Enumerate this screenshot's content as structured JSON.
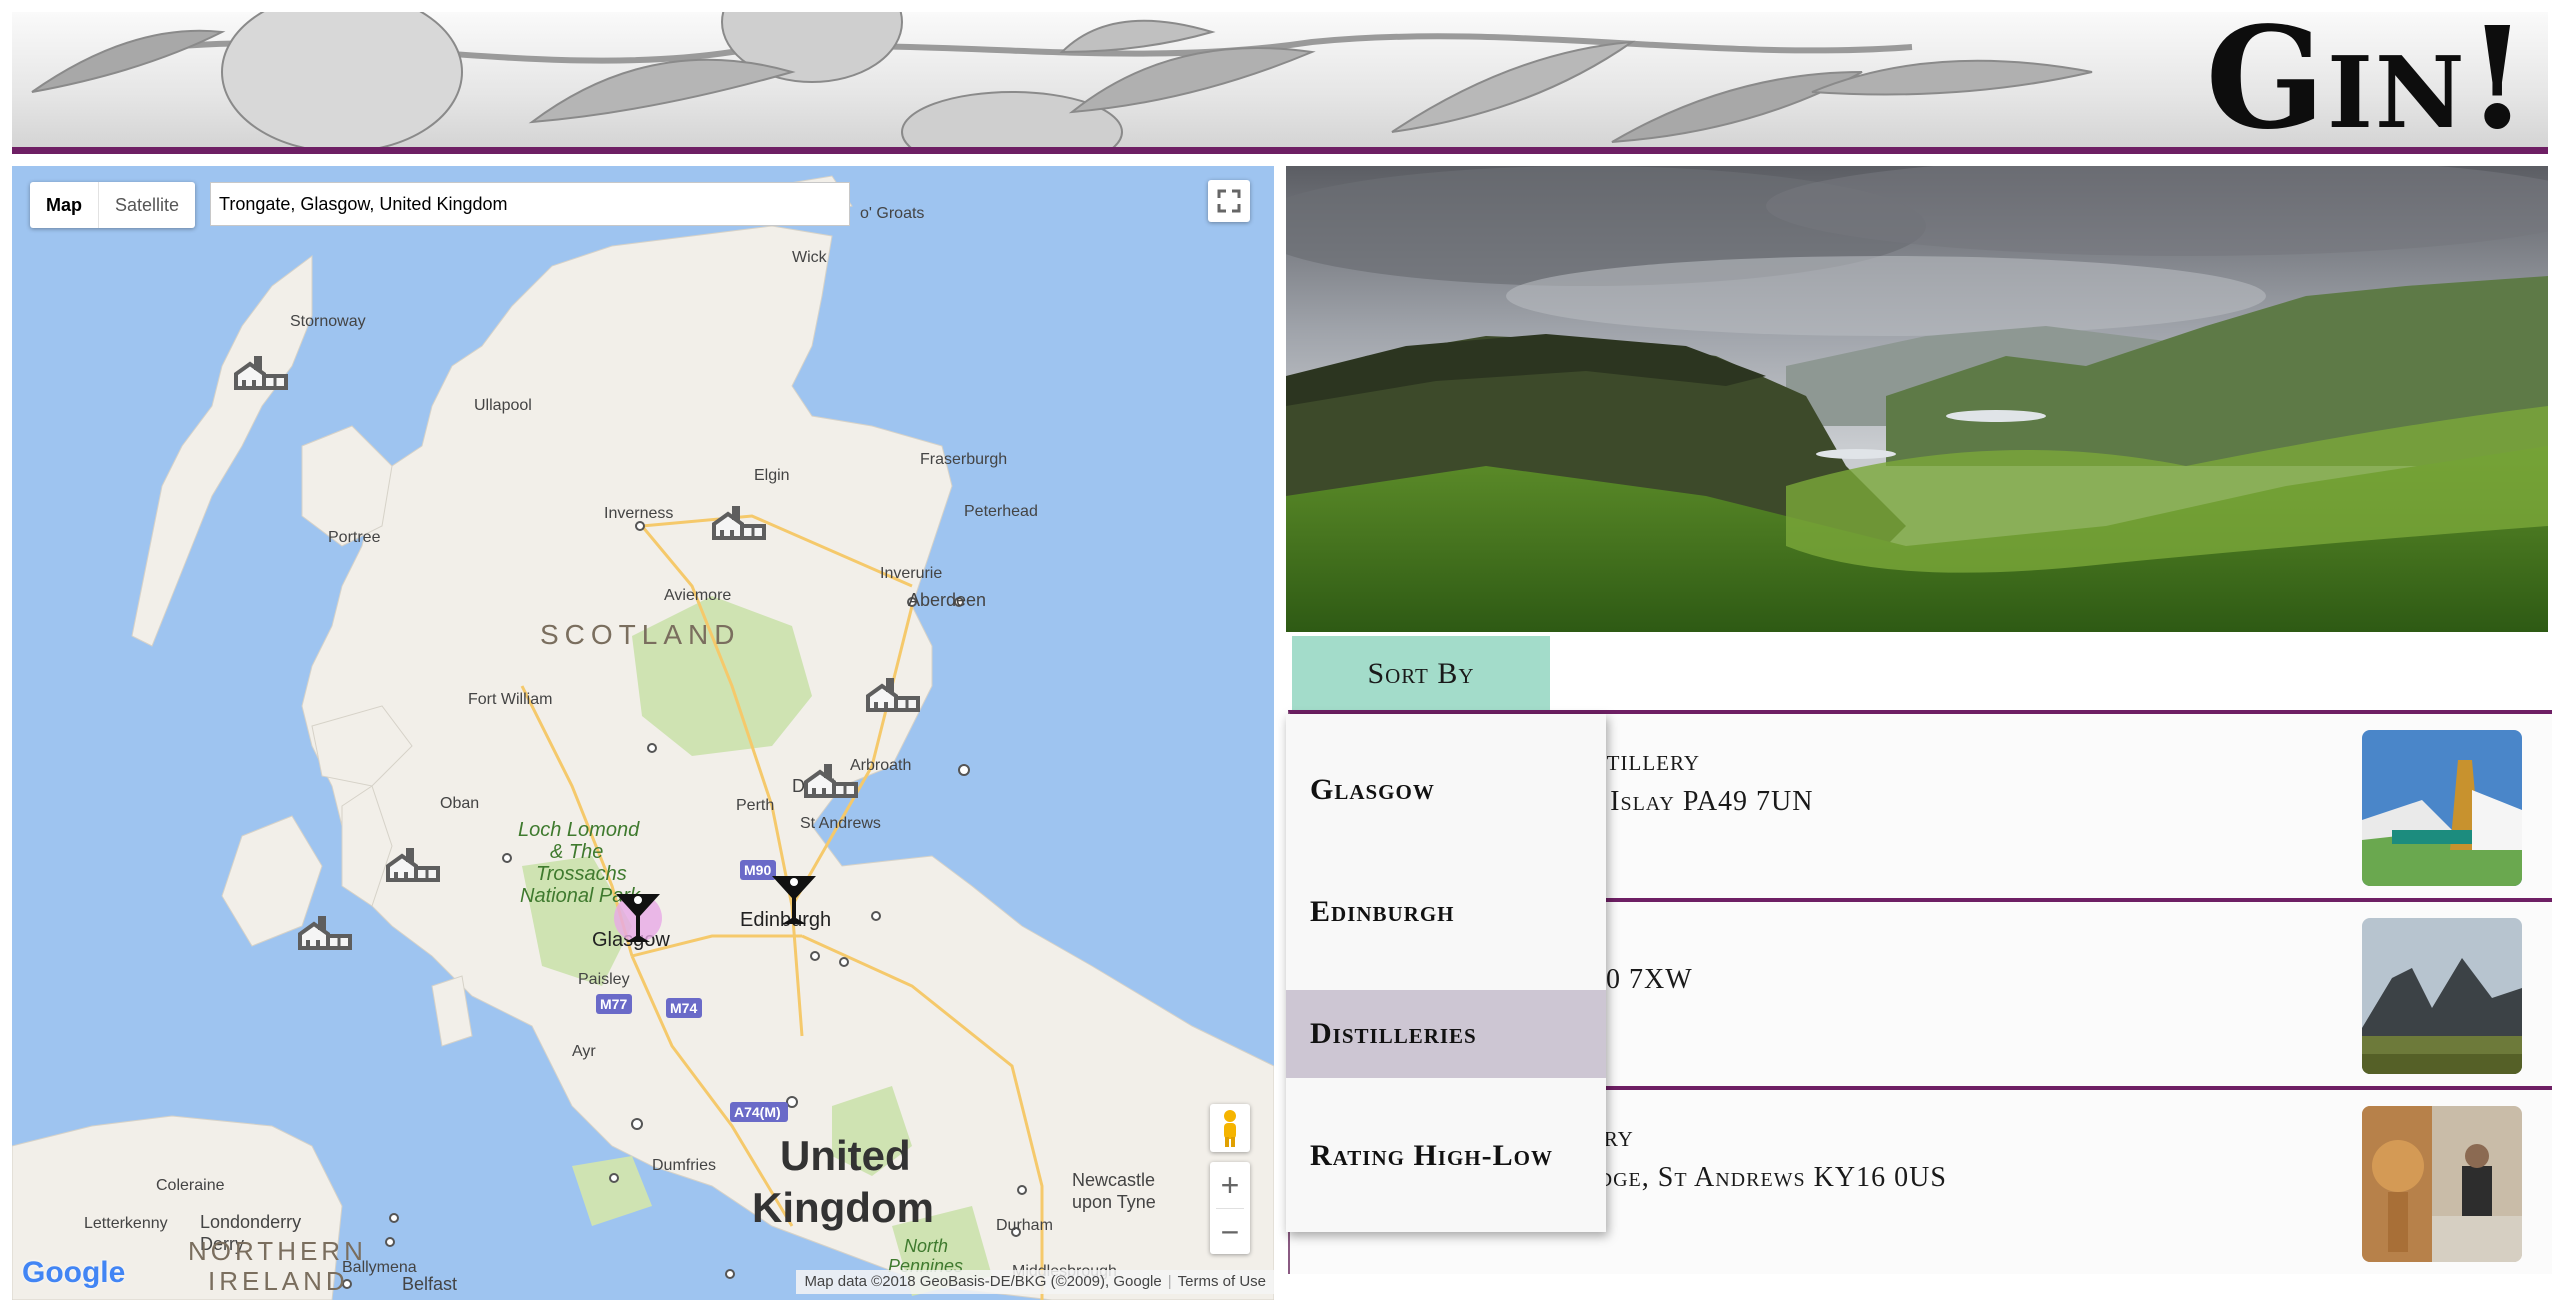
{
  "header": {
    "brand_title": "Gin!"
  },
  "map": {
    "type_control": {
      "map_label": "Map",
      "satellite_label": "Satellite",
      "active": "Map"
    },
    "search": {
      "value": "Trongate, Glasgow, United Kingdom"
    },
    "labels": {
      "groats": "o' Groats",
      "wick": "Wick",
      "stornoway": "Stornoway",
      "ullapool": "Ullapool",
      "fraserburgh": "Fraserburgh",
      "elgin": "Elgin",
      "peterhead": "Peterhead",
      "inverness": "Inverness",
      "portree": "Portree",
      "inverurie": "Inverurie",
      "aviemore": "Aviemore",
      "aberdeen": "Aberdeen",
      "scotland": "SCOTLAND",
      "fort_william": "Fort William",
      "arbroath": "Arbroath",
      "dundee": "Dundee",
      "oban": "Oban",
      "perth": "Perth",
      "st_andrews": "St Andrews",
      "loch_lomond_1": "Loch Lomond",
      "loch_lomond_2": "& The",
      "loch_lomond_3": "Trossachs",
      "loch_lomond_4": "National Park",
      "glasgow": "Glasgow",
      "edinburgh": "Edinburgh",
      "paisley": "Paisley",
      "ayr": "Ayr",
      "coleraine": "Coleraine",
      "letterkenny": "Letterkenny",
      "londonderry_1": "Londonderry",
      "londonderry_2": "Derry",
      "ballymena": "Ballymena",
      "dumfries": "Dumfries",
      "uk_1": "United",
      "uk_2": "Kingdom",
      "newcastle_1": "Newcastle",
      "newcastle_2": "upon Tyne",
      "durham": "Durham",
      "north_pennines_1": "North",
      "north_pennines_2": "Pennines",
      "middlesbrough": "Middlesbrough",
      "northern_ireland_1": "NORTHERN",
      "northern_ireland_2": "IRELAND",
      "belfast": "Belfast"
    },
    "road_shields": [
      "M90",
      "M77",
      "M74",
      "A74(M)"
    ],
    "google_logo": "Google",
    "attribution": "Map data ©2018 GeoBasis-DE/BKG (©2009), Google",
    "terms": "Terms of Use",
    "zoom_in": "+",
    "zoom_out": "−",
    "markers": {
      "distilleries": [
        "distillery-icon",
        "distillery-icon",
        "distillery-icon",
        "distillery-icon",
        "distillery-icon",
        "distillery-icon"
      ],
      "bars": [
        "cocktail-glass-icon",
        "cocktail-glass-icon"
      ]
    }
  },
  "sort": {
    "button_label": "Sort By",
    "options": [
      "Glasgow",
      "Edinburgh",
      "Distilleries",
      "Rating High-Low"
    ],
    "selected": "Distilleries"
  },
  "list": [
    {
      "title_visible": "istillery",
      "address_visible": "f Islay PA49 7UN"
    },
    {
      "title_visible": "",
      "address_visible": "0 7XW"
    },
    {
      "title_visible": "ery",
      "address_visible": "idge, St Andrews KY16 0US"
    }
  ],
  "colors": {
    "accent": "#6e1f64",
    "sort_button": "#a3dcca",
    "selected_option": "#cdc6d3",
    "map_water": "#9ec4f0"
  }
}
